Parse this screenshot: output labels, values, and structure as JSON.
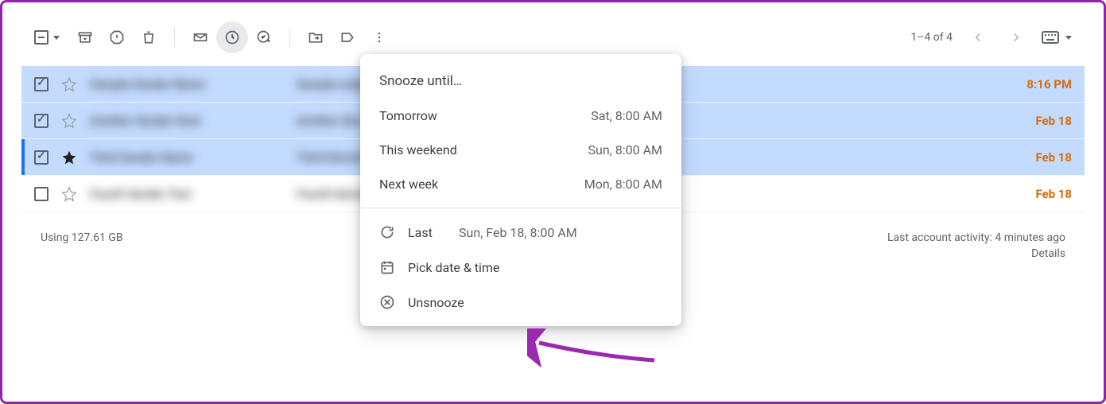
{
  "toolbar": {
    "pagination": "1–4 of 4"
  },
  "emails": [
    {
      "sender": "Sample Sender Name",
      "subject": "Sample subject line that is blurred content here for demo",
      "date": "8:16 PM",
      "selected": true,
      "checked": true,
      "starred": false,
      "accent": false
    },
    {
      "sender": "Another Sender Here",
      "subject": "Another blurred subject line for this email row content",
      "date": "Feb 18",
      "selected": true,
      "checked": true,
      "starred": false,
      "accent": false
    },
    {
      "sender": "Third Sender Name",
      "subject": "Third blurred email subject text showing here in row",
      "date": "Feb 18",
      "selected": true,
      "checked": true,
      "starred": true,
      "accent": true
    },
    {
      "sender": "Fourth Sender Text",
      "subject": "Fourth blurred subject line content for final row here",
      "date": "Feb 18",
      "selected": false,
      "checked": false,
      "starred": false,
      "accent": false
    }
  ],
  "footer": {
    "storage": "Using 127.61 GB",
    "activity": "Last account activity: 4 minutes ago",
    "details": "Details"
  },
  "menu": {
    "title": "Snooze until…",
    "options": [
      {
        "label": "Tomorrow",
        "time": "Sat, 8:00 AM"
      },
      {
        "label": "This weekend",
        "time": "Sun, 8:00 AM"
      },
      {
        "label": "Next week",
        "time": "Mon, 8:00 AM"
      }
    ],
    "last_label": "Last",
    "last_time": "Sun, Feb 18, 8:00 AM",
    "pick": "Pick date & time",
    "unsnooze": "Unsnooze"
  }
}
